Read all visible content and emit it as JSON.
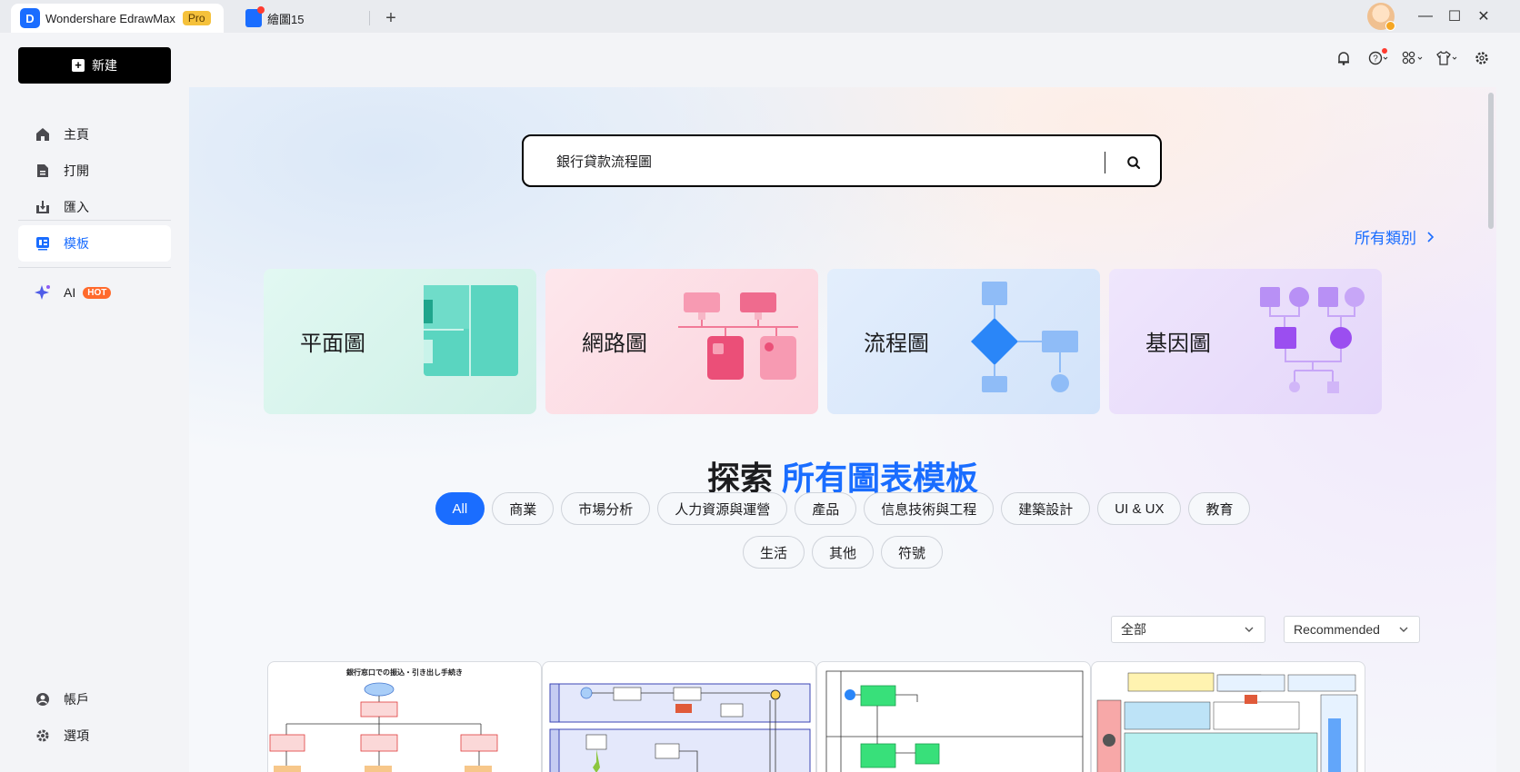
{
  "titlebar": {
    "app_name": "Wondershare EdrawMax",
    "pro_badge": "Pro",
    "doc_tab": "繪圖15",
    "add_tab": "+",
    "minimize": "—",
    "maximize": "☐",
    "close": "✕"
  },
  "sidebar": {
    "new_label": "新建",
    "items": [
      {
        "label": "主頁",
        "icon": "home-icon"
      },
      {
        "label": "打開",
        "icon": "open-file-icon"
      },
      {
        "label": "匯入",
        "icon": "import-icon"
      },
      {
        "label": "模板",
        "icon": "template-icon"
      },
      {
        "label": "AI",
        "icon": "ai-sparkle-icon"
      }
    ],
    "hot_badge": "HOT",
    "account": "帳戶",
    "options": "選項"
  },
  "search": {
    "value": "銀行貸款流程圖"
  },
  "all_categories": "所有類別",
  "categories": [
    {
      "label": "平面圖"
    },
    {
      "label": "網路圖"
    },
    {
      "label": "流程圖"
    },
    {
      "label": "基因圖"
    }
  ],
  "heading": {
    "part1": "探索",
    "part2": "所有圖表模板"
  },
  "chips_row1": [
    "All",
    "商業",
    "市場分析",
    "人力資源與運營",
    "產品",
    "信息技術與工程",
    "建築設計",
    "UI & UX",
    "教育"
  ],
  "chips_row2": [
    "生活",
    "其他",
    "符號"
  ],
  "filters": {
    "scope": "全部",
    "sort": "Recommended"
  },
  "templates": [
    {
      "title": "銀行窓口での振込・引き出し手続き"
    }
  ],
  "colors": {
    "accent": "#1a6dff",
    "card_floor": "#d6f5ec",
    "card_network": "#fddbe3",
    "card_flow": "#dbe8fb",
    "card_gene": "#ece2fb"
  }
}
